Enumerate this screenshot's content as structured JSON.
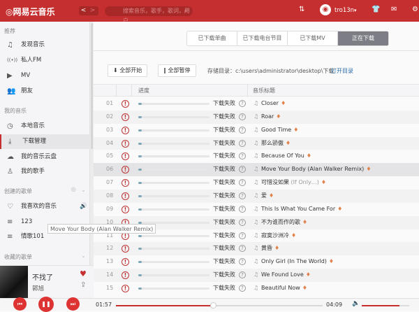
{
  "app": {
    "logo": "网易云音乐",
    "back": "<",
    "forward": ">",
    "search_placeholder": "搜索音乐，歌手，歌词，用户",
    "user": "tro13n",
    "user_caret": "▾"
  },
  "sidebar": {
    "sections": [
      {
        "label": "推荐"
      },
      {
        "label": "我的音乐"
      },
      {
        "label": "创建的歌单"
      },
      {
        "label": "收藏的歌单"
      }
    ],
    "items": [
      {
        "label": "发现音乐",
        "icon": "♫"
      },
      {
        "label": "私人FM",
        "icon": "((•))"
      },
      {
        "label": "MV",
        "icon": "▶"
      },
      {
        "label": "朋友",
        "icon": "👥"
      },
      {
        "label": "本地音乐",
        "icon": "◷"
      },
      {
        "label": "下载管理",
        "icon": "⤓"
      },
      {
        "label": "我的音乐云盘",
        "icon": "☁"
      },
      {
        "label": "我的歌手",
        "icon": "♙"
      },
      {
        "label": "我喜欢的音乐",
        "icon": "♡"
      },
      {
        "label": "123",
        "icon": "≡"
      },
      {
        "label": "情歌101",
        "icon": "≡"
      }
    ]
  },
  "now_playing": {
    "title": "不找了",
    "artist": "郭旭"
  },
  "tabs": [
    {
      "label": "已下载单曲"
    },
    {
      "label": "已下载电台节目"
    },
    {
      "label": "已下载MV"
    },
    {
      "label": "正在下载"
    }
  ],
  "toolbar": {
    "start_all": "全部开始",
    "pause_all": "全部暂停",
    "path_label": "存储目录：",
    "path": "c:\\users\\administrator\\desktop\\下载",
    "open_dir": "打开目录"
  },
  "table": {
    "headers": {
      "progress": "进度",
      "title": "音乐标题"
    },
    "rows": [
      {
        "num": "01",
        "status": "下载失败",
        "title": "Closer",
        "sub": "",
        "progress": 0.05
      },
      {
        "num": "02",
        "status": "下载失败",
        "title": "Roar",
        "sub": "",
        "progress": 0.05
      },
      {
        "num": "03",
        "status": "下载失败",
        "title": "Good Time",
        "sub": "",
        "progress": 0.05
      },
      {
        "num": "04",
        "status": "下载失败",
        "title": "那么骄傲",
        "sub": "",
        "progress": 0.05
      },
      {
        "num": "05",
        "status": "下载失败",
        "title": "Because Of You",
        "sub": "",
        "progress": 0.05
      },
      {
        "num": "06",
        "status": "下载失败",
        "title": "Move Your Body (Alan Walker Remix)",
        "sub": "",
        "progress": 0.05
      },
      {
        "num": "07",
        "status": "下载失败",
        "title": "可惜没如果",
        "sub": "(If Only…)",
        "progress": 0.05
      },
      {
        "num": "08",
        "status": "下载失败",
        "title": "爱",
        "sub": "",
        "progress": 0.05
      },
      {
        "num": "09",
        "status": "下载失败",
        "title": "This Is What You Came For",
        "sub": "",
        "progress": 0.05
      },
      {
        "num": "10",
        "status": "下载失败",
        "title": "不为谁而作的歌",
        "sub": "",
        "progress": 0.05
      },
      {
        "num": "11",
        "status": "下载失败",
        "title": "寂寞沙洲冷",
        "sub": "",
        "progress": 0.05
      },
      {
        "num": "12",
        "status": "下载失败",
        "title": "黄昏",
        "sub": "",
        "progress": 0.05
      },
      {
        "num": "13",
        "status": "下载失败",
        "title": "Only Girl (In The World)",
        "sub": "",
        "progress": 0.05
      },
      {
        "num": "14",
        "status": "下载失败",
        "title": "We Found Love",
        "sub": "",
        "progress": 0.05
      },
      {
        "num": "15",
        "status": "下载失败",
        "title": "Beautiful Now",
        "sub": "",
        "progress": 0.05
      }
    ]
  },
  "tooltip": "Move Your Body (Alan Walker Remix)",
  "player": {
    "elapsed": "01:57",
    "total": "04:09",
    "progress": 0.47,
    "volume": 0.8
  },
  "colors": {
    "brand": "#c62f2f"
  }
}
